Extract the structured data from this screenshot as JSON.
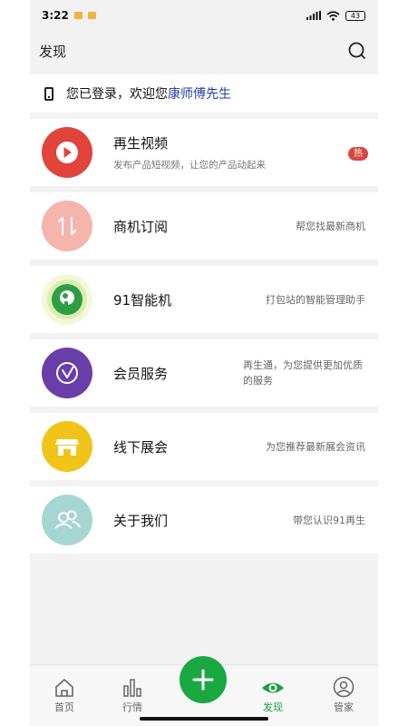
{
  "status": {
    "time": "3:22",
    "battery": "43"
  },
  "header": {
    "title": "发现",
    "search_icon": "search-icon"
  },
  "welcome": {
    "prefix": "您已登录，欢迎您",
    "name": "康师傅先生"
  },
  "items": [
    {
      "label": "再生视频",
      "sub": "发布产品短视频，让您的产品动起来",
      "desc": "",
      "badge": "热",
      "icon": "play-icon",
      "color": "#e0443a"
    },
    {
      "label": "商机订阅",
      "sub": "",
      "desc": "帮您找最新商机",
      "icon": "arrows-updown-icon",
      "color": "#f5b5ad"
    },
    {
      "label": "91智能机",
      "sub": "",
      "desc": "打包站的智能管理助手",
      "icon": "smart-device-icon",
      "color": "#2e9e45"
    },
    {
      "label": "会员服务",
      "sub": "",
      "desc": "再生通，为您提供更加优质的服务",
      "icon": "member-icon",
      "color": "#6a3ea8"
    },
    {
      "label": "线下展会",
      "sub": "",
      "desc": "为您推荐最新展会资讯",
      "icon": "store-icon",
      "color": "#f0c419"
    },
    {
      "label": "关于我们",
      "sub": "",
      "desc": "带您认识91再生",
      "icon": "people-icon",
      "color": "#a6d6d2"
    }
  ],
  "tabs": [
    {
      "label": "首页",
      "icon": "home-icon"
    },
    {
      "label": "行情",
      "icon": "bar-chart-icon"
    },
    {
      "label": "发现",
      "icon": "eye-icon",
      "active": true
    },
    {
      "label": "管家",
      "icon": "user-icon"
    }
  ],
  "colors": {
    "accent": "#1aa840",
    "link": "#1f3fa6",
    "hot": "#d9463e"
  }
}
